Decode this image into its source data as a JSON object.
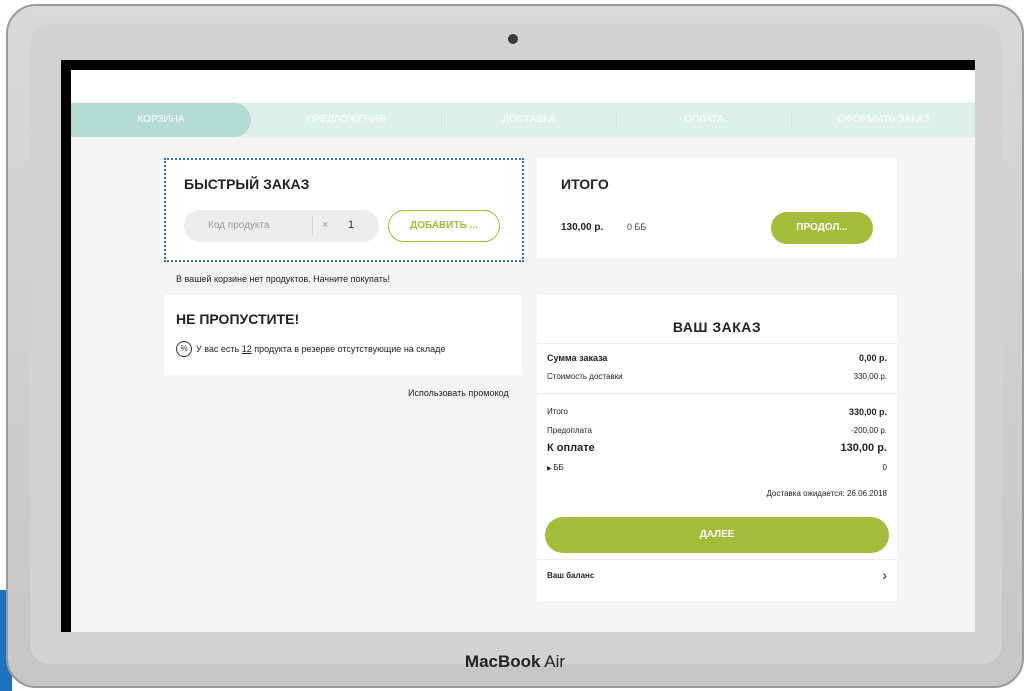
{
  "device": {
    "brand_bold": "MacBook",
    "brand_rest": " Air"
  },
  "steps": [
    {
      "label": "КОРЗИНА",
      "active": true
    },
    {
      "label": "ПРЕДЛОЖЕНИЯ",
      "active": false
    },
    {
      "label": "ДОСТАВКА",
      "active": false
    },
    {
      "label": "ОПЛАТА",
      "active": false
    },
    {
      "label": "ОФОРМИТЬ ЗАКАЗ",
      "active": false
    }
  ],
  "quick_order": {
    "title": "БЫСТРЫЙ ЗАКАЗ",
    "product_code_placeholder": "Код продукта",
    "times": "×",
    "quantity": "1",
    "add_button": "ДОБАВИТЬ ..."
  },
  "empty_cart_text": "В вашей корзине нет продуктов. Начните покупать!",
  "total_card": {
    "title": "ИТОГО",
    "amount": "130,00 р.",
    "bb": "0 ББ",
    "continue_button": "ПРОДОЛ..."
  },
  "dont_miss": {
    "title": "НЕ ПРОПУСТИТЕ!",
    "icon": "percent-icon",
    "text_before": "У вас есть ",
    "count": "12",
    "text_after": " продукта в резерве отсутствующие на складе"
  },
  "promo_link": "Использовать промокод",
  "order": {
    "title": "ВАШ ЗАКАЗ",
    "sum_label": "Сумма заказа",
    "sum_value": "0,00 р.",
    "delivery_label": "Стоимость доставки",
    "delivery_value": "330,00 р.",
    "total_label": "Итого",
    "total_value": "330,00 р.",
    "prepay_label": "Предоплата",
    "prepay_value": "-200,00 р.",
    "to_pay_label": "К оплате",
    "to_pay_value": "130,00 р.",
    "bb_label": "ББ",
    "bb_value": "0",
    "delivery_expected": "Доставка ожидается: 26.06.2018",
    "next_button": "ДАЛЕЕ",
    "balance_label": "Ваш баланс"
  },
  "colors": {
    "accent_green": "#a3bd3a",
    "step_bar": "#dcefe9",
    "step_active": "#b4dbd2",
    "focus_outline": "#2d6fb5"
  }
}
